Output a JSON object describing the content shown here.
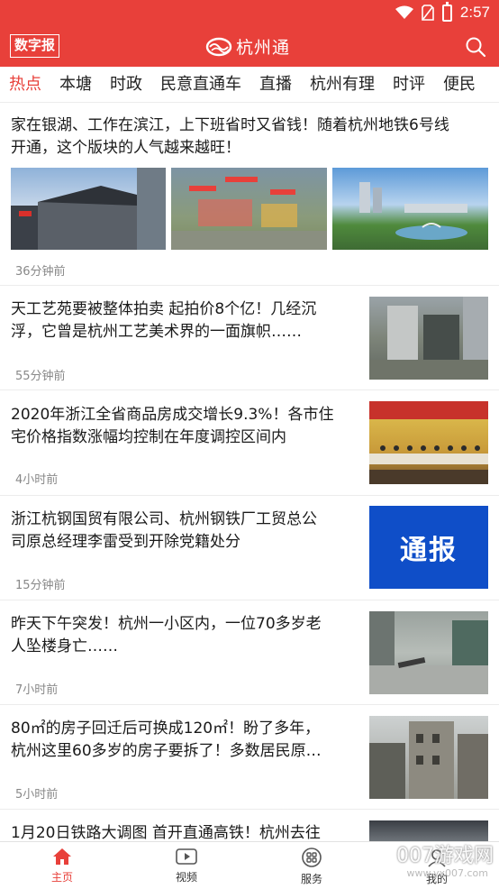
{
  "status_bar": {
    "time": "2:57"
  },
  "header": {
    "digital_paper_label": "数字报",
    "app_title": "杭州通"
  },
  "tabs": [
    {
      "label": "热点",
      "active": true
    },
    {
      "label": "本塘"
    },
    {
      "label": "时政"
    },
    {
      "label": "民意直通车"
    },
    {
      "label": "直播"
    },
    {
      "label": "杭州有理"
    },
    {
      "label": "时评"
    },
    {
      "label": "便民"
    }
  ],
  "news": [
    {
      "title_lines": [
        "家在银湖、工作在滨江，上下班省时又省钱！随着杭州地铁6号线",
        "开通，这个版块的人气越来越旺！"
      ],
      "time": "36分钟前"
    },
    {
      "title_lines": [
        "天工艺苑要被整体拍卖 起拍价8个亿！几经沉",
        "浮，它曾是杭州工艺美术界的一面旗帜……"
      ],
      "time": "55分钟前"
    },
    {
      "title_lines": [
        "2020年浙江全省商品房成交增长9.3%！各市住",
        "宅价格指数涨幅均控制在年度调控区间内"
      ],
      "time": "4小时前"
    },
    {
      "title_lines": [
        "浙江杭钢国贸有限公司、杭州钢铁厂工贸总公",
        "司原总经理李雷受到开除党籍处分"
      ],
      "time": "15分钟前",
      "thumb_text": "通报"
    },
    {
      "title_lines": [
        "昨天下午突发！杭州一小区内，一位70多岁老",
        "人坠楼身亡……"
      ],
      "time": "7小时前"
    },
    {
      "title_lines": [
        "80㎡的房子回迁后可换成120㎡！盼了多年，",
        "杭州这里60多岁的房子要拆了！多数居民原…"
      ],
      "time": "5小时前"
    },
    {
      "title_lines": [
        "1月20日铁路大调图 首开直通高铁！杭州去往"
      ],
      "time": ""
    }
  ],
  "bottom_nav": [
    {
      "label": "主页",
      "icon": "home-icon",
      "active": true
    },
    {
      "label": "视频",
      "icon": "video-icon"
    },
    {
      "label": "服务",
      "icon": "grid-icon"
    },
    {
      "label": "我的",
      "icon": "user-icon"
    }
  ],
  "watermark": {
    "text": "007游戏网",
    "url": "www.yx007.com"
  },
  "colors": {
    "brand": "#e8403a",
    "text": "#1a1a1a",
    "muted": "#888888"
  }
}
